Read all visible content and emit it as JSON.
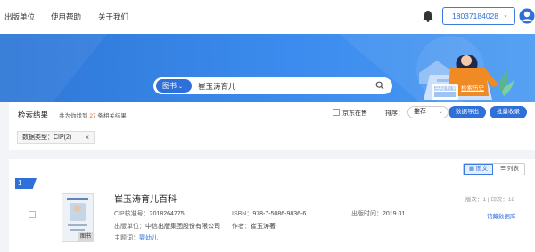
{
  "nav": {
    "links": [
      "出版单位",
      "使用帮助",
      "关于我们"
    ],
    "account": "18037184028"
  },
  "search": {
    "type": "图书",
    "query": "崔玉涛育儿",
    "advanced_link": "高级检索",
    "history_link": "检索历史"
  },
  "results": {
    "title": "检索结果",
    "count_prefix": "共为你找到",
    "count": "27",
    "count_suffix": "条相关结果",
    "in_stock_label": "京东在售",
    "sort_label": "排序：",
    "sort_value": "推荐",
    "export_button": "数据导出",
    "batch_button": "批量收录",
    "filter_tag": "数据类型：CIP(2)",
    "filter_close": "×"
  },
  "view": {
    "graphic": "图文",
    "list": "列表"
  },
  "item": {
    "rank": "1",
    "cover_tag": "图书",
    "title": "崔玉涛育儿百科",
    "cip_label": "CIP核准号：",
    "cip": "2018264775",
    "isbn_label": "ISBN：",
    "isbn": "978-7-5086-9836-6",
    "date_label": "出版时间：",
    "date": "2019.01",
    "publisher_label": "出版单位：",
    "publisher": "中信出版集团股份有限公司",
    "author_label": "作者：",
    "author": "崔玉涛著",
    "subject_label": "主题词：",
    "subject": "婴幼儿",
    "edition": "版次：1 | 印次：18",
    "source_link": "馆藏数据库"
  },
  "colors": {
    "accent": "#2f6fd8",
    "banner": "#3b8cee",
    "orange": "#f08a24"
  }
}
